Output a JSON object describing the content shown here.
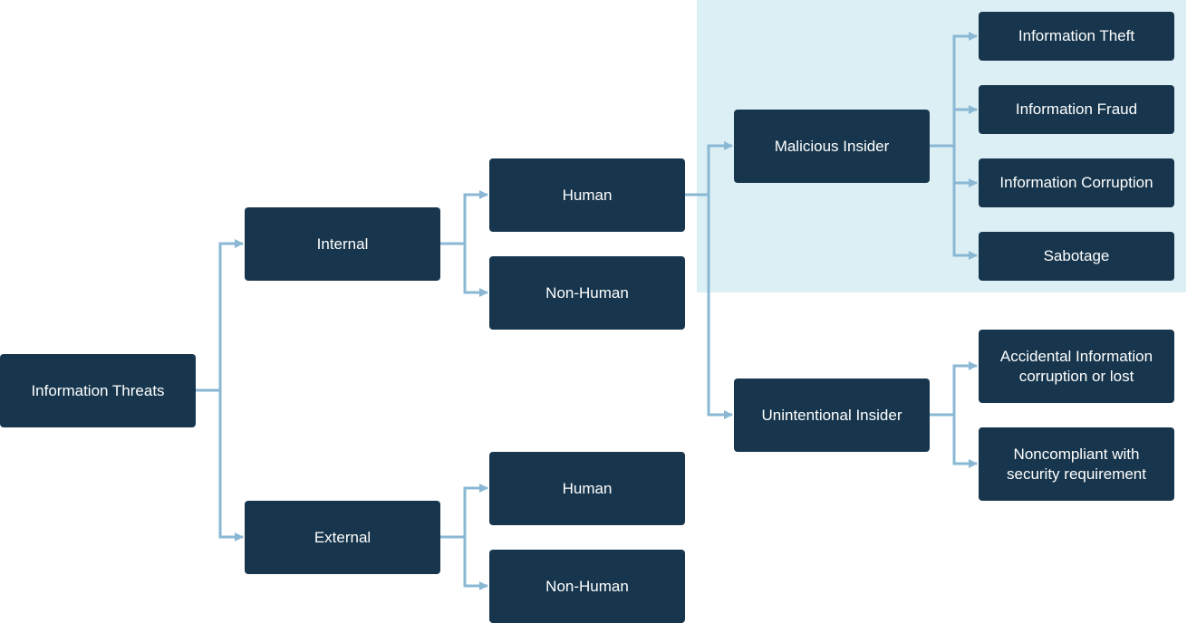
{
  "diagram": {
    "title": "Information Threats",
    "colors": {
      "node": "#17364d",
      "text": "#ffffff",
      "connector": "#8ab8d4",
      "highlight": "#dceff5"
    },
    "nodes": {
      "root": "Information Threats",
      "internal": "Internal",
      "external": "External",
      "internal_human": "Human",
      "internal_nonhuman": "Non-Human",
      "external_human": "Human",
      "external_nonhuman": "Non-Human",
      "malicious": "Malicious Insider",
      "unintentional": "Unintentional Insider",
      "theft": "Information Theft",
      "fraud": "Information Fraud",
      "corruption": "Information Corruption",
      "sabotage": "Sabotage",
      "accidental": "Accidental Information corruption or lost",
      "noncompliant": "Noncompliant with security requirement"
    },
    "edges": [
      [
        "root",
        "internal"
      ],
      [
        "root",
        "external"
      ],
      [
        "internal",
        "internal_human"
      ],
      [
        "internal",
        "internal_nonhuman"
      ],
      [
        "external",
        "external_human"
      ],
      [
        "external",
        "external_nonhuman"
      ],
      [
        "internal_human",
        "malicious"
      ],
      [
        "internal_human",
        "unintentional"
      ],
      [
        "malicious",
        "theft"
      ],
      [
        "malicious",
        "fraud"
      ],
      [
        "malicious",
        "corruption"
      ],
      [
        "malicious",
        "sabotage"
      ],
      [
        "unintentional",
        "accidental"
      ],
      [
        "unintentional",
        "noncompliant"
      ]
    ]
  }
}
